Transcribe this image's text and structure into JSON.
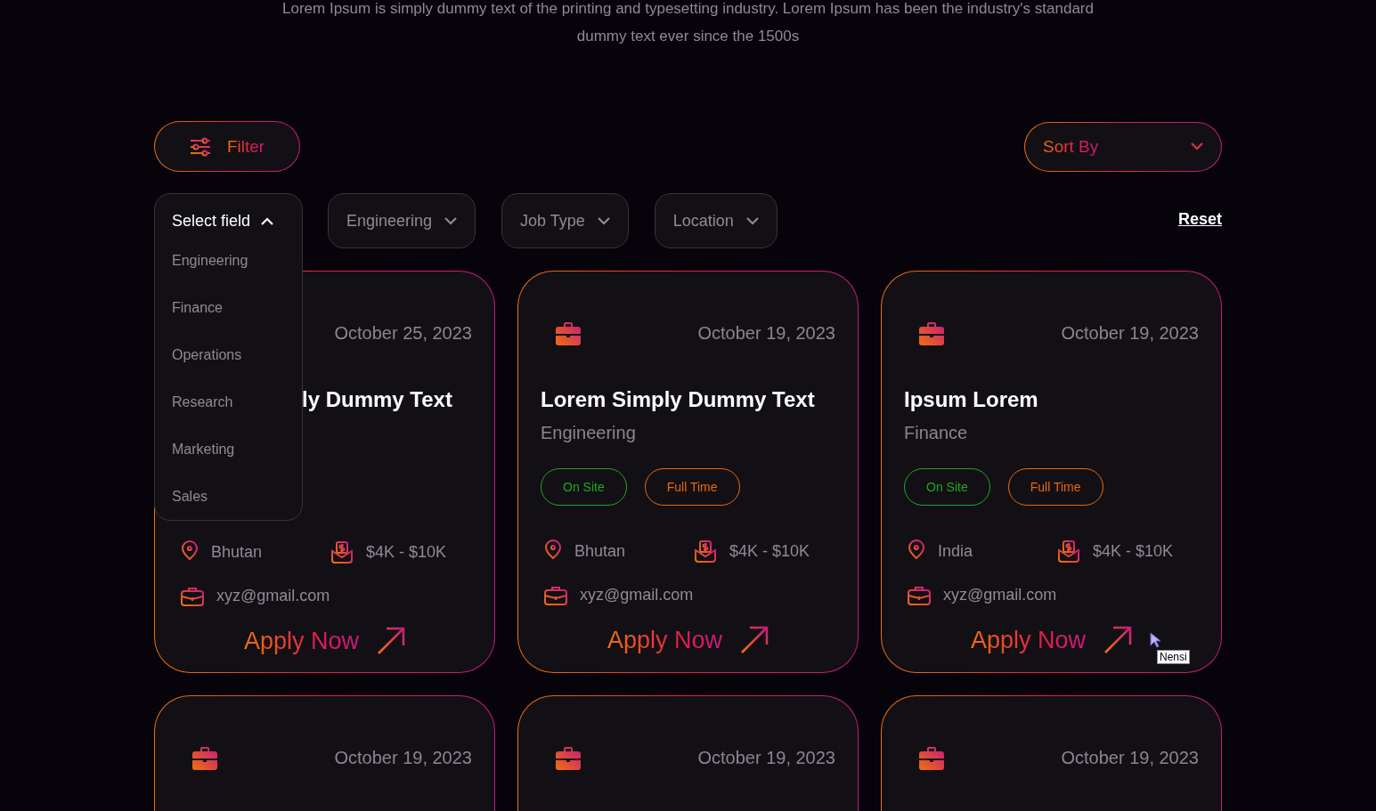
{
  "intro": "Lorem Ipsum is simply dummy text of the printing and typesetting industry. Lorem Ipsum has been the industry's standard dummy text ever since the 1500s",
  "filter_button": {
    "label": "Filter"
  },
  "sort": {
    "label": "Sort By"
  },
  "field_select": {
    "label": "Select field",
    "expanded": true,
    "options": [
      "Engineering",
      "Finance",
      "Operations",
      "Research",
      "Marketing",
      "Sales"
    ]
  },
  "selects": [
    {
      "label": "Engineering"
    },
    {
      "label": "Job Type"
    },
    {
      "label": "Location"
    }
  ],
  "reset": "Reset",
  "jobs": [
    {
      "kind": "covered",
      "date": "October 25, 2023",
      "title": "ly Dummy Text",
      "location": "Bhutan",
      "salary": "$4K - $10K",
      "email": "xyz@gmail.com",
      "action": "Apply Now"
    },
    {
      "kind": "full",
      "date": "October 19, 2023",
      "title": "Lorem Simply Dummy Text",
      "category": "Engineering",
      "tags": [
        {
          "label": "On Site",
          "color": "#1ea81e"
        },
        {
          "label": "Full Time",
          "color": "#e8680c"
        }
      ],
      "location": "Bhutan",
      "salary": "$4K - $10K",
      "email": "xyz@gmail.com",
      "action": "Apply Now"
    },
    {
      "kind": "full",
      "date": "October 19, 2023",
      "title": "Ipsum Lorem",
      "category": "Finance",
      "tags": [
        {
          "label": "On Site",
          "color": "#1ea81e"
        },
        {
          "label": "Full Time",
          "color": "#e8680c"
        }
      ],
      "location": "India",
      "salary": "$4K - $10K",
      "email": "xyz@gmail.com",
      "action": "Apply Now",
      "tooltip": "Nensi"
    },
    {
      "kind": "cut",
      "date": "October 19, 2023"
    },
    {
      "kind": "cut",
      "date": "October 19, 2023"
    },
    {
      "kind": "cut",
      "date": "October 19, 2023"
    }
  ]
}
